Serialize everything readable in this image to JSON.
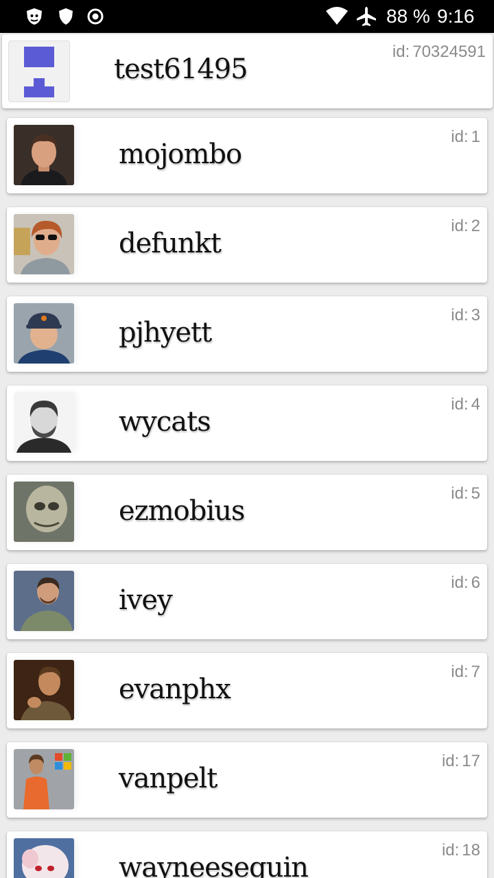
{
  "status_bar": {
    "battery": "88 %",
    "time": "9:16",
    "icons": [
      "security-shield-icon",
      "shield-icon",
      "record-icon",
      "wifi-icon",
      "airplane-icon"
    ]
  },
  "current_user": {
    "username": "test61495",
    "id_label": "id:",
    "id": "70324591",
    "avatar_icon": "identicon"
  },
  "users": [
    {
      "username": "mojombo",
      "id_label": "id:",
      "id": "1"
    },
    {
      "username": "defunkt",
      "id_label": "id:",
      "id": "2"
    },
    {
      "username": "pjhyett",
      "id_label": "id:",
      "id": "3"
    },
    {
      "username": "wycats",
      "id_label": "id:",
      "id": "4"
    },
    {
      "username": "ezmobius",
      "id_label": "id:",
      "id": "5"
    },
    {
      "username": "ivey",
      "id_label": "id:",
      "id": "6"
    },
    {
      "username": "evanphx",
      "id_label": "id:",
      "id": "7"
    },
    {
      "username": "vanpelt",
      "id_label": "id:",
      "id": "17"
    },
    {
      "username": "wayneeseguin",
      "id_label": "id:",
      "id": "18"
    }
  ],
  "colors": {
    "identicon": "#5b5bd6",
    "page_bg": "#ececec",
    "card_bg": "#ffffff"
  }
}
